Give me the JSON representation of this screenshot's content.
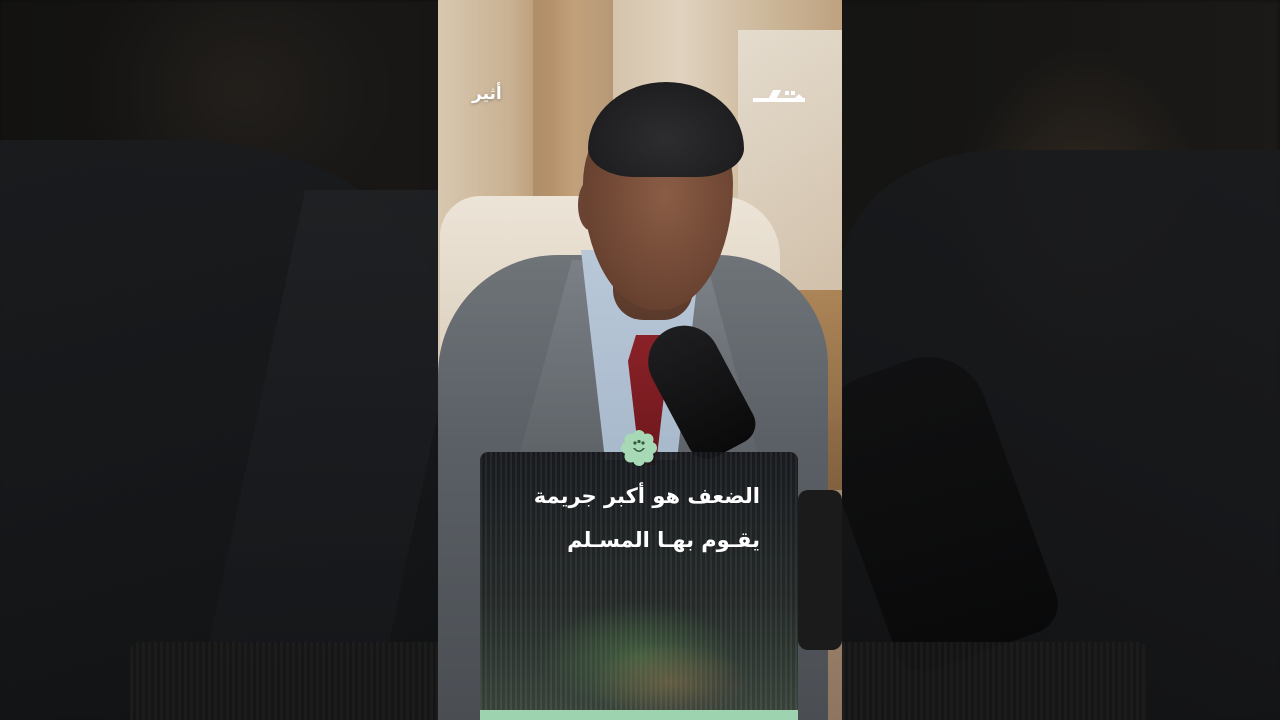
{
  "overlay": {
    "channel_name": "أثير",
    "brand_logo_icon": "stylized-arabic-logo-icon",
    "badge_icon": "green-flower-badge-icon"
  },
  "caption": {
    "lines": [
      "الضعف هو أكبر جريمة",
      "يقـوم بهـا المسـلم"
    ]
  },
  "playback": {
    "progress_bar_color": "#9ed3b0"
  },
  "colors": {
    "accent": "#9ed3b0",
    "tie": "#8a2228"
  }
}
